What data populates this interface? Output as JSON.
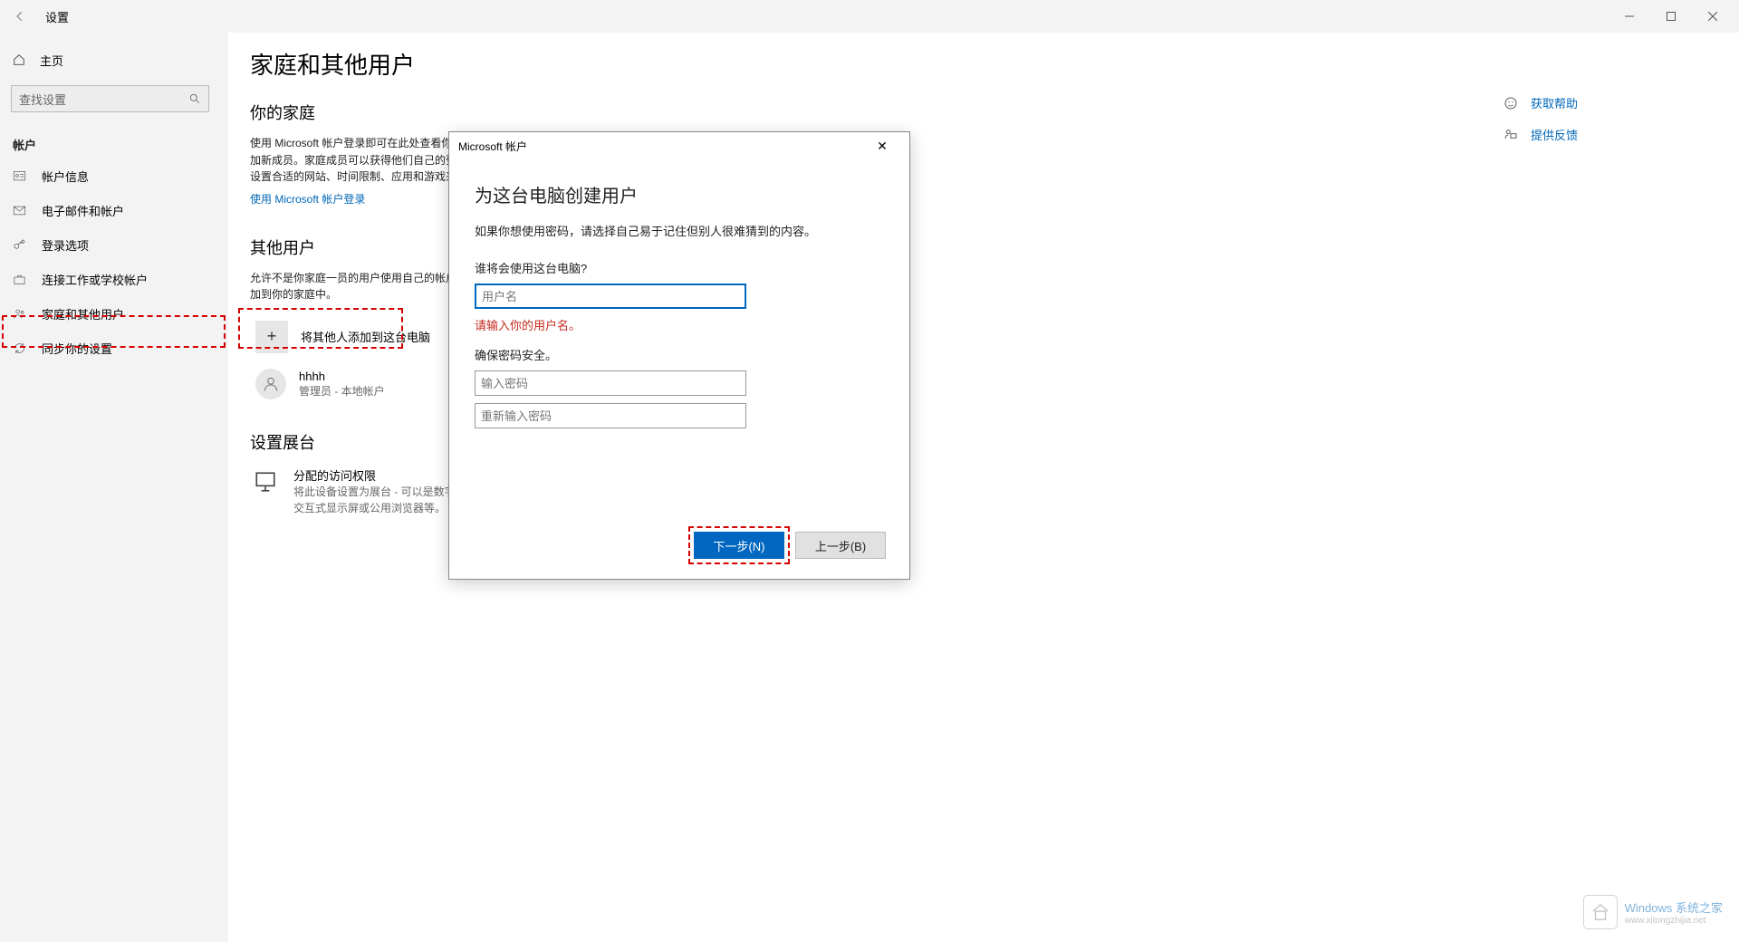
{
  "window": {
    "title": "设置"
  },
  "sidebar": {
    "home": "主页",
    "search_placeholder": "查找设置",
    "group": "帐户",
    "items": [
      {
        "label": "帐户信息"
      },
      {
        "label": "电子邮件和帐户"
      },
      {
        "label": "登录选项"
      },
      {
        "label": "连接工作或学校帐户"
      },
      {
        "label": "家庭和其他用户"
      },
      {
        "label": "同步你的设置"
      }
    ]
  },
  "main": {
    "title": "家庭和其他用户",
    "family_heading": "你的家庭",
    "family_desc": "使用 Microsoft 帐户登录即可在此处查看你的家庭，或向你的家庭添加新成员。家庭成员可以获得他们自己的登录名和桌面。你可以通过设置合适的网站、时间限制、应用和游戏来确保孩子们的安全。",
    "family_link": "使用 Microsoft 帐户登录",
    "others_heading": "其他用户",
    "others_desc": "允许不是你家庭一员的用户使用自己的帐户来登录。这样不会将其添加到你的家庭中。",
    "add_other": "将其他人添加到这台电脑",
    "user": {
      "name": "hhhh",
      "sub": "管理员 - 本地帐户"
    },
    "kiosk_heading": "设置展台",
    "kiosk_title": "分配的访问权限",
    "kiosk_sub": "将此设备设置为展台 - 可以是数字标牌、交互式显示屏或公用浏览器等。"
  },
  "right": {
    "help": "获取帮助",
    "feedback": "提供反馈"
  },
  "dialog": {
    "window_title": "Microsoft 帐户",
    "heading": "为这台电脑创建用户",
    "subtext": "如果你想使用密码，请选择自己易于记住但别人很难猜到的内容。",
    "who_label": "谁将会使用这台电脑?",
    "username_placeholder": "用户名",
    "error_text": "请输入你的用户名。",
    "password_label": "确保密码安全。",
    "password_placeholder": "输入密码",
    "password_confirm_placeholder": "重新输入密码",
    "next_btn": "下一步(N)",
    "back_btn": "上一步(B)"
  },
  "watermark": {
    "line1": "Windows 系统之家",
    "line2": "www.xitongzhijia.net"
  }
}
